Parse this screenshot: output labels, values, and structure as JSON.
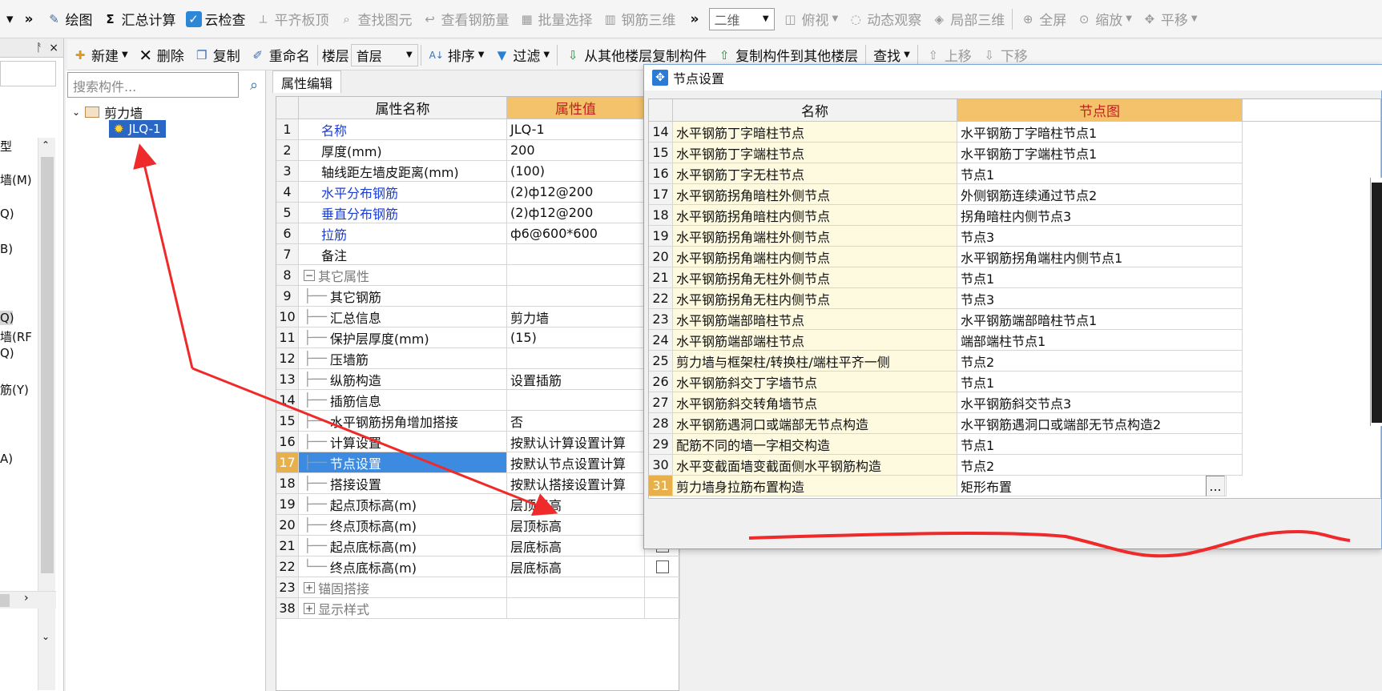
{
  "toolbar1": {
    "overflow_left": "»",
    "items": [
      {
        "icon": "pencil-icon",
        "label": "绘图",
        "disabled": false
      },
      {
        "icon": "sigma-icon",
        "label": "汇总计算",
        "disabled": false
      },
      {
        "icon": "check-icon",
        "label": "云检查",
        "disabled": false
      },
      {
        "icon": "align-top-icon",
        "label": "平齐板顶",
        "disabled": true
      },
      {
        "icon": "find-icon",
        "label": "查找图元",
        "disabled": true
      },
      {
        "icon": "view-rebar-icon",
        "label": "查看钢筋量",
        "disabled": true
      },
      {
        "icon": "batch-select-icon",
        "label": "批量选择",
        "disabled": true
      },
      {
        "icon": "rebar-3d-icon",
        "label": "钢筋三维",
        "disabled": true
      }
    ],
    "overflow_right": "»",
    "view_mode": "二维",
    "view_items": [
      {
        "icon": "top-view-icon",
        "label": "俯视",
        "disabled": true
      },
      {
        "icon": "orbit-icon",
        "label": "动态观察",
        "disabled": true
      },
      {
        "icon": "local-3d-icon",
        "label": "局部三维",
        "disabled": true
      },
      {
        "icon": "fullscreen-icon",
        "label": "全屏",
        "disabled": true
      },
      {
        "icon": "zoom-icon",
        "label": "缩放",
        "disabled": true
      },
      {
        "icon": "pan-icon",
        "label": "平移",
        "disabled": true
      }
    ]
  },
  "toolbar2": {
    "new": "新建",
    "delete": "删除",
    "copy": "复制",
    "rename": "重命名",
    "floor_label": "楼层",
    "floor_value": "首层",
    "sort": "排序",
    "filter": "过滤",
    "copy_from_floor": "从其他楼层复制构件",
    "copy_to_floor": "复制构件到其他楼层",
    "find": "查找",
    "move_up": "上移",
    "move_down": "下移"
  },
  "left_panel": {
    "pin": "ᚨ",
    "close": "×",
    "items": [
      "型",
      "墙(M)",
      "Q)",
      "B)",
      "Q)",
      "墙(RF",
      "Q)",
      "筋(Y)",
      "A)"
    ]
  },
  "tree": {
    "search_placeholder": "搜索构件...",
    "root": "剪力墙",
    "child": "JLQ-1"
  },
  "property_editor": {
    "tab": "属性编辑",
    "col_name": "属性名称",
    "col_value": "属性值",
    "rows": [
      {
        "num": "1",
        "name": "名称",
        "value": "JLQ-1"
      },
      {
        "num": "2",
        "name": "厚度(mm)",
        "value": "200"
      },
      {
        "num": "3",
        "name": "轴线距左墙皮距离(mm)",
        "value": "(100)"
      },
      {
        "num": "4",
        "name": "水平分布钢筋",
        "value": "(2)ф12@200"
      },
      {
        "num": "5",
        "name": "垂直分布钢筋",
        "value": "(2)ф12@200"
      },
      {
        "num": "6",
        "name": "拉筋",
        "value": "ф6@600*600"
      },
      {
        "num": "7",
        "name": "备注",
        "value": ""
      },
      {
        "num": "8",
        "name": "其它属性",
        "value": ""
      },
      {
        "num": "9",
        "name": "其它钢筋",
        "value": ""
      },
      {
        "num": "10",
        "name": "汇总信息",
        "value": "剪力墙"
      },
      {
        "num": "11",
        "name": "保护层厚度(mm)",
        "value": "(15)"
      },
      {
        "num": "12",
        "name": "压墙筋",
        "value": ""
      },
      {
        "num": "13",
        "name": "纵筋构造",
        "value": "设置插筋"
      },
      {
        "num": "14",
        "name": "插筋信息",
        "value": ""
      },
      {
        "num": "15",
        "name": "水平钢筋拐角增加搭接",
        "value": "否"
      },
      {
        "num": "16",
        "name": "计算设置",
        "value": "按默认计算设置计算"
      },
      {
        "num": "17",
        "name": "节点设置",
        "value": "按默认节点设置计算"
      },
      {
        "num": "18",
        "name": "搭接设置",
        "value": "按默认搭接设置计算"
      },
      {
        "num": "19",
        "name": "起点顶标高(m)",
        "value": "层顶标高"
      },
      {
        "num": "20",
        "name": "终点顶标高(m)",
        "value": "层顶标高"
      },
      {
        "num": "21",
        "name": "起点底标高(m)",
        "value": "层底标高"
      },
      {
        "num": "22",
        "name": "终点底标高(m)",
        "value": "层底标高"
      },
      {
        "num": "23",
        "name": "锚固搭接",
        "value": ""
      },
      {
        "num": "38",
        "name": "显示样式",
        "value": ""
      }
    ]
  },
  "node_dialog": {
    "title": "节点设置",
    "col_name": "名称",
    "col_node": "节点图",
    "rows": [
      {
        "num": "14",
        "name": "水平钢筋丁字暗柱节点",
        "node": "水平钢筋丁字暗柱节点1"
      },
      {
        "num": "15",
        "name": "水平钢筋丁字端柱节点",
        "node": "水平钢筋丁字端柱节点1"
      },
      {
        "num": "16",
        "name": "水平钢筋丁字无柱节点",
        "node": "节点1"
      },
      {
        "num": "17",
        "name": "水平钢筋拐角暗柱外侧节点",
        "node": "外侧钢筋连续通过节点2"
      },
      {
        "num": "18",
        "name": "水平钢筋拐角暗柱内侧节点",
        "node": "拐角暗柱内侧节点3"
      },
      {
        "num": "19",
        "name": "水平钢筋拐角端柱外侧节点",
        "node": "节点3"
      },
      {
        "num": "20",
        "name": "水平钢筋拐角端柱内侧节点",
        "node": "水平钢筋拐角端柱内侧节点1"
      },
      {
        "num": "21",
        "name": "水平钢筋拐角无柱外侧节点",
        "node": "节点1"
      },
      {
        "num": "22",
        "name": "水平钢筋拐角无柱内侧节点",
        "node": "节点3"
      },
      {
        "num": "23",
        "name": "水平钢筋端部暗柱节点",
        "node": "水平钢筋端部暗柱节点1"
      },
      {
        "num": "24",
        "name": "水平钢筋端部端柱节点",
        "node": "端部端柱节点1"
      },
      {
        "num": "25",
        "name": "剪力墙与框架柱/转换柱/端柱平齐一侧",
        "node": "节点2"
      },
      {
        "num": "26",
        "name": "水平钢筋斜交丁字墙节点",
        "node": "节点1"
      },
      {
        "num": "27",
        "name": "水平钢筋斜交转角墙节点",
        "node": "水平钢筋斜交节点3"
      },
      {
        "num": "28",
        "name": "水平钢筋遇洞口或端部无节点构造",
        "node": "水平钢筋遇洞口或端部无节点构造2"
      },
      {
        "num": "29",
        "name": "配筋不同的墙一字相交构造",
        "node": "节点1"
      },
      {
        "num": "30",
        "name": "水平变截面墙变截面侧水平钢筋构造",
        "node": "节点2"
      },
      {
        "num": "31",
        "name": "剪力墙身拉筋布置构造",
        "node": "矩形布置"
      }
    ],
    "ellipsis": "..."
  },
  "colors": {
    "annotation_red": "#ee2a2a",
    "selection_blue": "#3c8be0",
    "value_header": "#f4c26a"
  }
}
